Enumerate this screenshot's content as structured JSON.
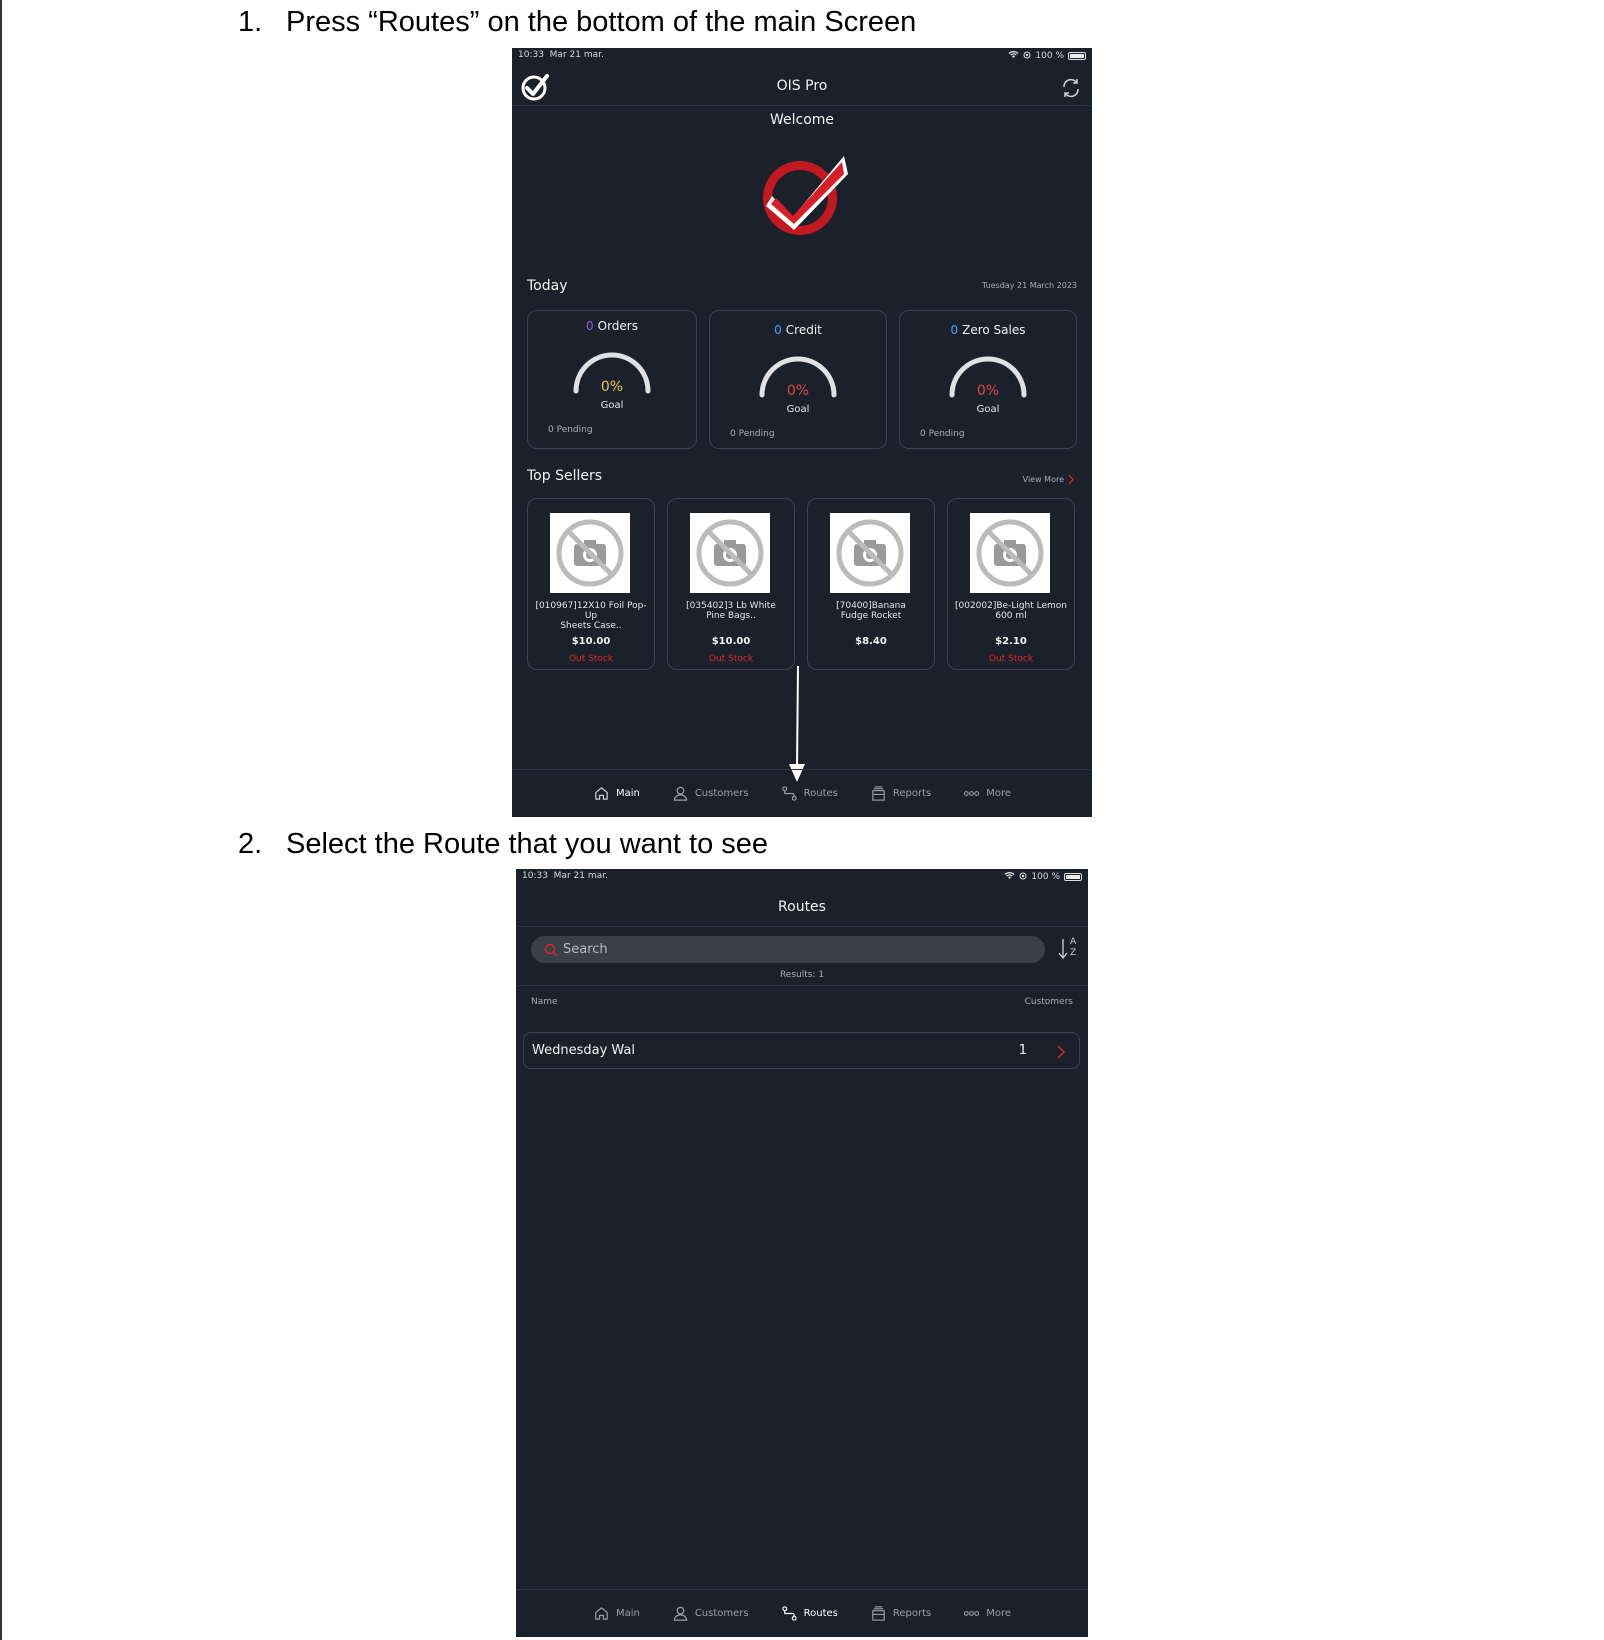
{
  "steps": [
    {
      "number": "1.",
      "text": "Press “Routes” on the bottom of the main Screen"
    },
    {
      "number": "2.",
      "text": "Select the Route that you want to see"
    }
  ],
  "status_bar": {
    "time": "10:33",
    "date": "Mar 21 mar.",
    "battery": "100 %"
  },
  "main_screen": {
    "app_title": "OIS Pro",
    "welcome": "Welcome",
    "today_label": "Today",
    "today_date": "Tuesday 21 March 2023",
    "stats": [
      {
        "count": "0",
        "label": "Orders",
        "count_color": "#8b5cf6",
        "percent": "0%",
        "percent_color": "#e8c45a",
        "goal": "Goal",
        "pending": "0  Pending",
        "progress": 0
      },
      {
        "count": "0",
        "label": "Credit",
        "count_color": "#4a9eff",
        "percent": "0%",
        "percent_color": "#e04848",
        "goal": "Goal",
        "pending": "0  Pending",
        "progress": 0
      },
      {
        "count": "0",
        "label": "Zero Sales",
        "count_color": "#4a9eff",
        "percent": "0%",
        "percent_color": "#e04848",
        "goal": "Goal",
        "pending": "0  Pending",
        "progress": 0
      }
    ],
    "top_sellers_label": "Top Sellers",
    "view_more": "View More",
    "products": [
      {
        "name_line1": "[010967]12X10 Foil Pop-Up",
        "name_line2": "Sheets Case..",
        "price": "$10.00",
        "stock": "Out Stock"
      },
      {
        "name_line1": "[035402]3 Lb White",
        "name_line2": "Pine Bags..",
        "price": "$10.00",
        "stock": "Out Stock"
      },
      {
        "name_line1": "[70400]Banana",
        "name_line2": "Fudge Rocket",
        "price": "$8.40",
        "stock": ""
      },
      {
        "name_line1": "[002002]Be-Light Lemon",
        "name_line2": "600 ml",
        "price": "$2.10",
        "stock": "Out Stock"
      }
    ]
  },
  "tabs": {
    "main": "Main",
    "customers": "Customers",
    "routes": "Routes",
    "reports": "Reports",
    "more": "More"
  },
  "routes_screen": {
    "title": "Routes",
    "search_placeholder": "Search",
    "sort_a": "A",
    "sort_z": "Z",
    "results": "Results: 1",
    "col_name": "Name",
    "col_customers": "Customers",
    "rows": [
      {
        "name": "Wednesday Wal",
        "customers": "1"
      }
    ]
  },
  "colors": {
    "background": "#1b212b",
    "accent_red": "#e0242a",
    "border": "#3a4250"
  }
}
